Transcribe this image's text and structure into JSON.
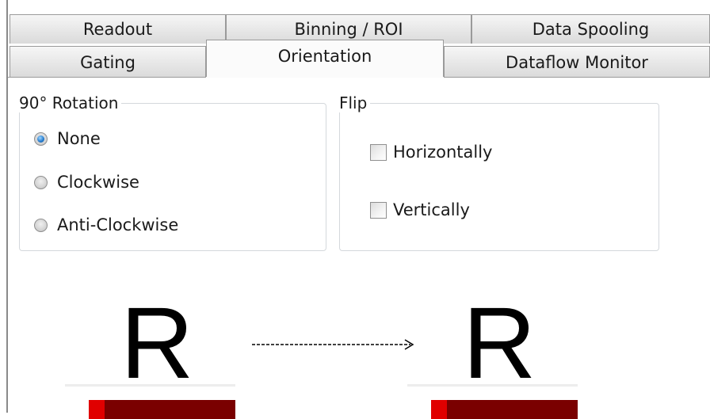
{
  "tabs": {
    "row1": [
      {
        "label": "Readout"
      },
      {
        "label": "Binning / ROI"
      },
      {
        "label": "Data Spooling"
      }
    ],
    "row2": [
      {
        "label": "Gating"
      },
      {
        "label": "Orientation",
        "active": true
      },
      {
        "label": "Dataflow Monitor"
      }
    ]
  },
  "rotation": {
    "legend": "90° Rotation",
    "options": [
      {
        "label": "None",
        "selected": true
      },
      {
        "label": "Clockwise",
        "selected": false
      },
      {
        "label": "Anti-Clockwise",
        "selected": false
      }
    ]
  },
  "flip": {
    "legend": "Flip",
    "options": [
      {
        "label": "Horizontally",
        "checked": false
      },
      {
        "label": "Vertically",
        "checked": false
      }
    ]
  },
  "preview": {
    "source_letter": "R",
    "result_letter": "R"
  },
  "colors": {
    "accent_radio": "#2a7fd0",
    "bar_dark": "#7a0000",
    "bar_bright": "#e00000"
  }
}
